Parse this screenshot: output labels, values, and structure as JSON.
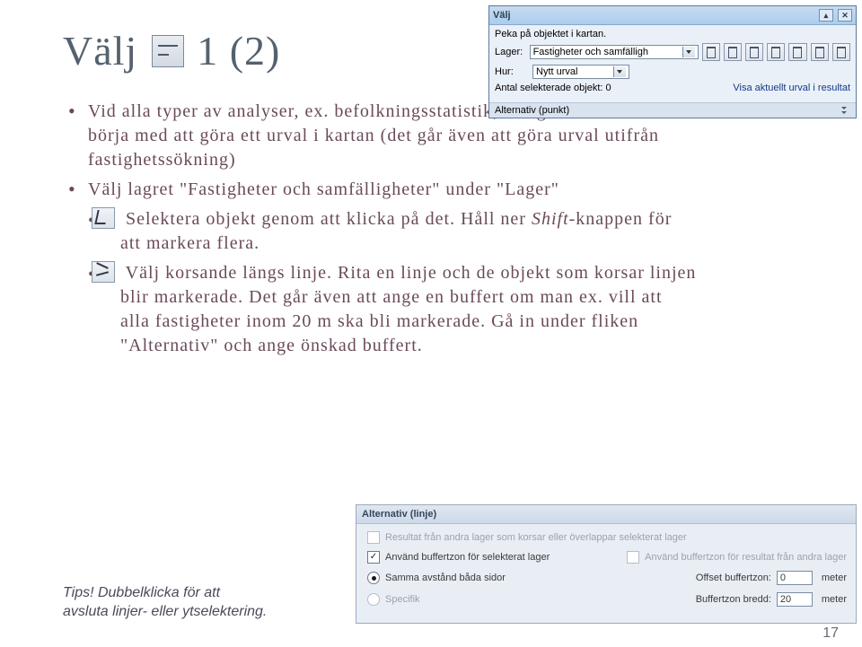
{
  "title": {
    "word1": "Välj",
    "word2": "1 (2)"
  },
  "bullets": {
    "b1_part1": "Vid alla typer av analyser, ex. befolkningsstatistik, sök grannar måste man börja med att göra ett urval i kartan (det går även att göra urval utifrån fastighetssökning)",
    "b2": "Välj lagret \"Fastigheter och samfälligheter\" under \"Lager\"",
    "s1_a": "Selektera objekt genom att klicka på det. Håll ner ",
    "s1_em": "Shift",
    "s1_b": "-knappen för att markera flera.",
    "s2": "Välj korsande längs linje. Rita en linje och de objekt som korsar linjen blir markerade. Det går även att ange en buffert om man ex. vill att alla fastigheter inom 20 m ska bli markerade. Gå in under fliken \"Alternativ\" och ange önskad buffert."
  },
  "toolbar": {
    "title": "Välj",
    "instruction": "Peka på objektet i kartan.",
    "lager_label": "Lager:",
    "lager_value": "Fastigheter och samfälligh",
    "hur_label": "Hur:",
    "hur_value": "Nytt urval",
    "count_label": "Antal selekterade objekt: 0",
    "result_link": "Visa aktuellt urval i resultat",
    "footer": "Alternativ (punkt)"
  },
  "tips": {
    "lead": "Tips!",
    "text": " Dubbelklicka för att avsluta linjer- eller ytselektering."
  },
  "altpanel": {
    "title": "Alternativ (linje)",
    "line1": "Resultat från andra lager som korsar eller överlappar selekterat lager",
    "chk_use_buffer": "Använd buffertzon för selekterat lager",
    "chk_result_buffer": "Använd buffertzon för resultat från andra lager",
    "radio_same": "Samma avstånd båda sidor",
    "radio_specific": "Specifik",
    "offset_label": "Offset buffertzon:",
    "offset_value": "0",
    "width_label": "Buffertzon bredd:",
    "width_value": "20",
    "unit": "meter"
  },
  "page_number": "17"
}
